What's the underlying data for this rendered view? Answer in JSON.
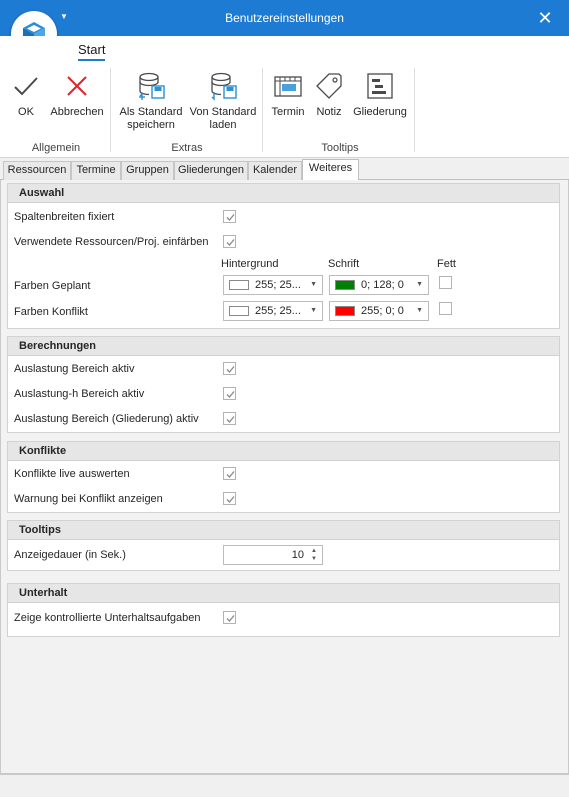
{
  "window": {
    "title": "Benutzereinstellungen"
  },
  "ribbon": {
    "tab": "Start",
    "groups": {
      "allgemein": "Allgemein",
      "extras": "Extras",
      "tooltips": "Tooltips"
    },
    "buttons": {
      "ok": "OK",
      "abbrechen": "Abbrechen",
      "als_standard_1": "Als Standard",
      "als_standard_2": "speichern",
      "von_standard_1": "Von Standard",
      "von_standard_2": "laden",
      "termin": "Termin",
      "notiz": "Notiz",
      "gliederung": "Gliederung"
    }
  },
  "tabs": [
    "Ressourcen",
    "Termine",
    "Gruppen",
    "Gliederungen",
    "Kalender",
    "Weiteres"
  ],
  "active_tab": "Weiteres",
  "sections": {
    "auswahl": {
      "title": "Auswahl",
      "spaltenbreiten": "Spaltenbreiten fixiert",
      "ressourcen_einfaerben": "Verwendete Ressourcen/Proj. einfärben",
      "col_hintergrund": "Hintergrund",
      "col_schrift": "Schrift",
      "col_fett": "Fett",
      "farben_geplant": "Farben Geplant",
      "farben_konflikt": "Farben Konflikt",
      "geplant_bg": "255; 25...",
      "geplant_fg": "0; 128; 0",
      "konflikt_bg": "255; 25...",
      "konflikt_fg": "255; 0; 0",
      "geplant_bg_color": "#ffffff",
      "geplant_fg_color": "#008000",
      "konflikt_bg_color": "#ffffff",
      "konflikt_fg_color": "#ff0000"
    },
    "berechnungen": {
      "title": "Berechnungen",
      "auslastung": "Auslastung Bereich aktiv",
      "auslastung_h": "Auslastung-h Bereich aktiv",
      "auslastung_gliederung": "Auslastung Bereich (Gliederung) aktiv"
    },
    "konflikte": {
      "title": "Konflikte",
      "live": "Konflikte live auswerten",
      "warnung": "Warnung bei Konflikt anzeigen"
    },
    "tooltips": {
      "title": "Tooltips",
      "anzeigedauer": "Anzeigedauer (in Sek.)",
      "anzeigedauer_value": "10"
    },
    "unterhalt": {
      "title": "Unterhalt",
      "kontrollierte": "Zeige kontrollierte Unterhaltsaufgaben"
    }
  },
  "colors": {
    "accent": "#1e7bd4",
    "ok_icon": "#4a4a4a",
    "cancel_icon": "#e0242a",
    "extras_icon": "#2a8fd6"
  }
}
